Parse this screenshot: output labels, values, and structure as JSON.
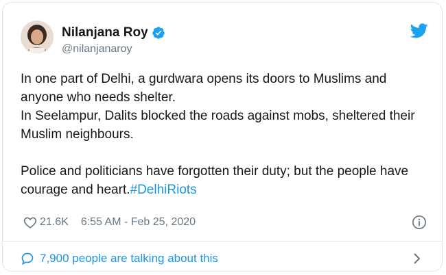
{
  "author": {
    "name": "Nilanjana Roy",
    "handle": "@nilanjanaroy"
  },
  "tweet": {
    "line1": "In one part of Delhi, a gurdwara opens its doors to Muslims and anyone who needs shelter.",
    "line2": "In Seelampur, Dalits blocked the roads against mobs, sheltered their Muslim neighbours.",
    "line3": "Police and politicians have forgotten their duty; but the people have courage and heart.",
    "hashtag": "#DelhiRiots"
  },
  "meta": {
    "likes": "21.6K",
    "timestamp": "6:55 AM - Feb 25, 2020"
  },
  "footer": {
    "talking": "7,900 people are talking about this"
  },
  "colors": {
    "accent": "#1b95e0",
    "muted": "#657786",
    "text": "#14171a"
  },
  "icons": [
    "avatar",
    "verified-badge-icon",
    "twitter-bird-icon",
    "heart-icon",
    "info-icon",
    "speech-bubble-icon",
    "chevron-right-icon"
  ]
}
